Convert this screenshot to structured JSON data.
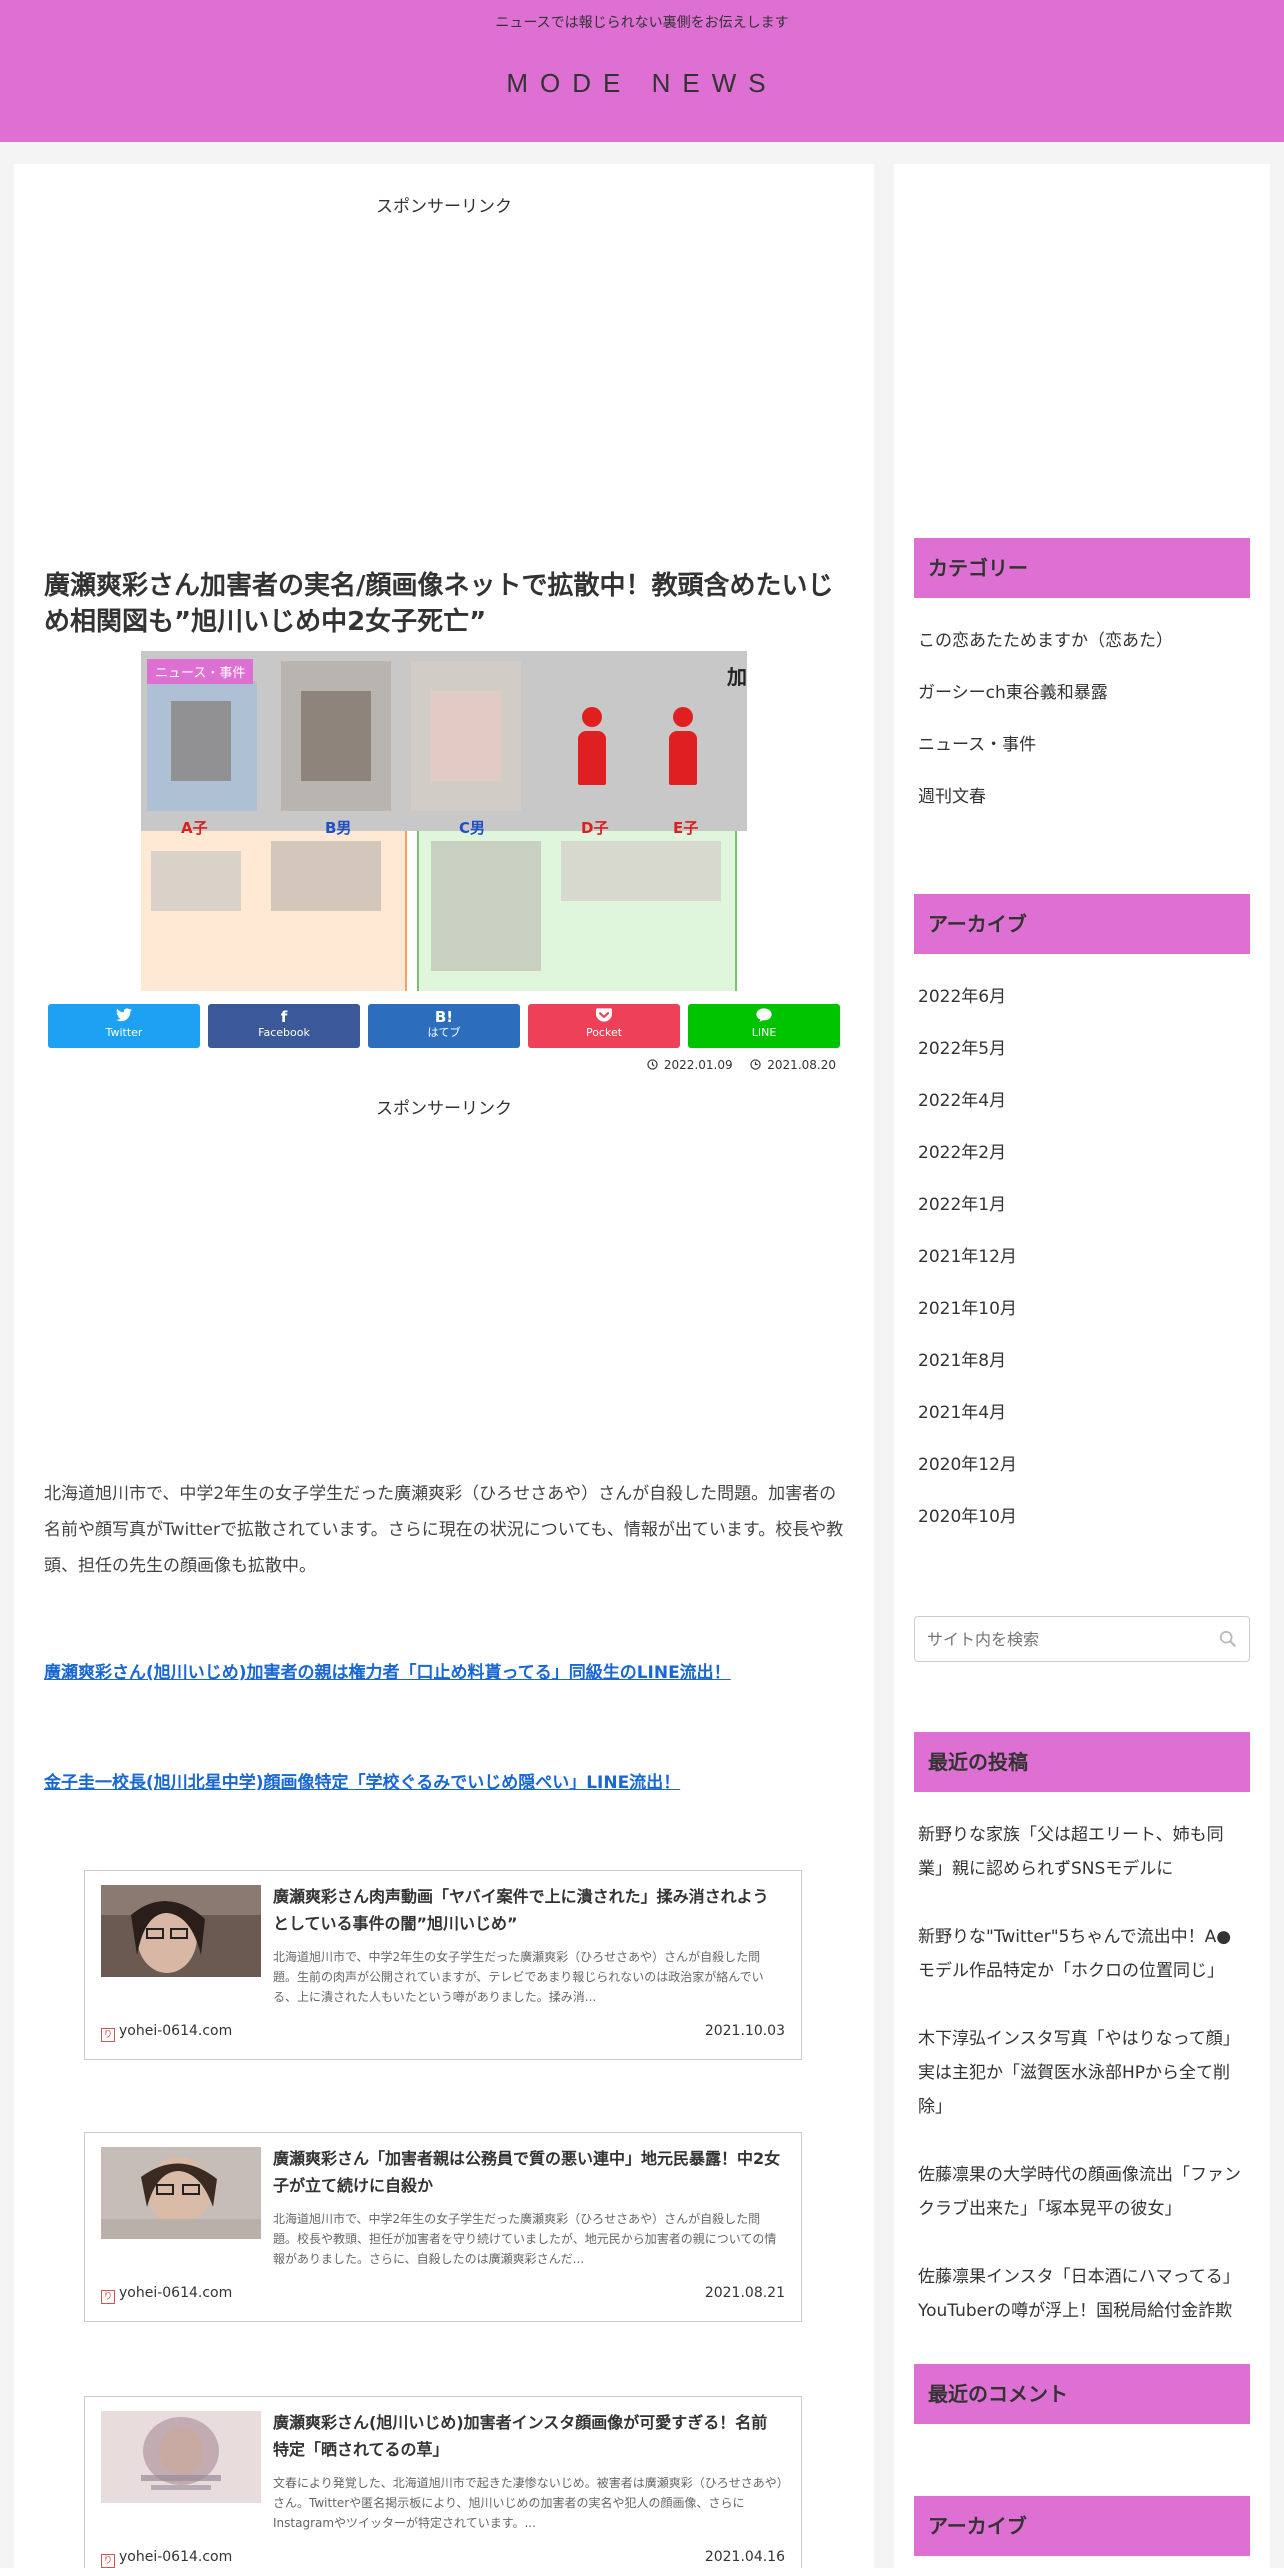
{
  "header": {
    "tagline": "ニュースでは報じられない裏側をお伝えします",
    "site_title": "MODE NEWS"
  },
  "article": {
    "sponsor_label": "スポンサーリンク",
    "title": "廣瀬爽彩さん加害者の実名/顔画像ネットで拡散中！教頭含めたいじめ相関図も”旭川いじめ中2女子死亡”",
    "category_badge": "ニュース・事件",
    "eyecatch_labels": [
      "A子",
      "B男",
      "C男",
      "D子",
      "E子"
    ],
    "eyecatch_kanji": "加",
    "share": [
      {
        "icon": "twitter-icon",
        "glyph": "🐦",
        "label": "Twitter"
      },
      {
        "icon": "facebook-icon",
        "glyph": "f",
        "label": "Facebook"
      },
      {
        "icon": "hatena-icon",
        "glyph": "B!",
        "label": "はてブ"
      },
      {
        "icon": "pocket-icon",
        "glyph": "⌵",
        "label": "Pocket"
      },
      {
        "icon": "line-icon",
        "glyph": "●",
        "label": "LINE"
      }
    ],
    "updated": "2022.01.09",
    "published": "2021.08.20",
    "body": "北海道旭川市で、中学2年生の女子学生だった廣瀬爽彩（ひろせさあや）さんが自殺した問題。加害者の名前や顔写真がTwitterで拡散されています。さらに現在の状況についても、情報が出ています。校長や教頭、担任の先生の顔画像も拡散中。",
    "links": [
      "廣瀬爽彩さん(旭川いじめ)加害者の親は権力者「口止め料貰ってる」同級生のLINE流出！",
      "金子圭一校長(旭川北星中学)顔画像特定「学校ぐるみでいじめ隠ぺい」LINE流出！"
    ],
    "cards": [
      {
        "title": "廣瀬爽彩さん肉声動画「ヤバイ案件で上に潰された」揉み消されようとしている事件の闇”旭川いじめ”",
        "snippet": "北海道旭川市で、中学2年生の女子学生だった廣瀬爽彩（ひろせさあや）さんが自殺した問題。生前の肉声が公開されていますが、テレビであまり報じられないのは政治家が絡んでいる、上に潰された人もいたという噂がありました。揉み消...",
        "site": "yohei-0614.com",
        "date": "2021.10.03"
      },
      {
        "title": "廣瀬爽彩さん「加害者親は公務員で質の悪い連中」地元民暴露！中2女子が立て続けに自殺か",
        "snippet": "北海道旭川市で、中学2年生の女子学生だった廣瀬爽彩（ひろせさあや）さんが自殺した問題。校長や教頭、担任が加害者を守り続けていましたが、地元民から加害者の親についての情報がありました。さらに、自殺したのは廣瀬爽彩さんだ...",
        "site": "yohei-0614.com",
        "date": "2021.08.21"
      },
      {
        "title": "廣瀬爽彩さん(旭川いじめ)加害者インスタ顔画像が可愛すぎる！名前特定「晒されてるの草」",
        "snippet": "文春により発覚した、北海道旭川市で起きた凄惨ないじめ。被害者は廣瀬爽彩（ひろせさあや）さん。Twitterや匿名掲示板により、旭川いじめの加害者の実名や犯人の顔画像、さらにInstagramやツイッターが特定されています。...",
        "site": "yohei-0614.com",
        "date": "2021.04.16"
      }
    ]
  },
  "sidebar": {
    "categories_title": "カテゴリー",
    "categories": [
      "この恋あたためますか（恋あた）",
      "ガーシーch東谷義和暴露",
      "ニュース・事件",
      "週刊文春"
    ],
    "archive_title": "アーカイブ",
    "archives": [
      "2022年6月",
      "2022年5月",
      "2022年4月",
      "2022年2月",
      "2022年1月",
      "2021年12月",
      "2021年10月",
      "2021年8月",
      "2021年4月",
      "2020年12月",
      "2020年10月"
    ],
    "search_placeholder": "サイト内を検索",
    "recent_title": "最近の投稿",
    "recent_posts": [
      "新野りな家族「父は超エリート、姉も同業」親に認められずSNSモデルに",
      "新野りな\"Twitter\"5ちゃんで流出中！A●モデル作品特定か「ホクロの位置同じ」",
      "木下淳弘インスタ写真「やはりなって顔」実は主犯か「滋賀医水泳部HPから全て削除」",
      "佐藤凛果の大学時代の顔画像流出「ファンクラブ出来た」「塚本晃平の彼女」",
      "佐藤凛果インスタ「日本酒にハマってる」YouTuberの噂が浮上！国税局給付金詐欺"
    ],
    "comments_title": "最近のコメント",
    "archive2_title": "アーカイブ"
  }
}
